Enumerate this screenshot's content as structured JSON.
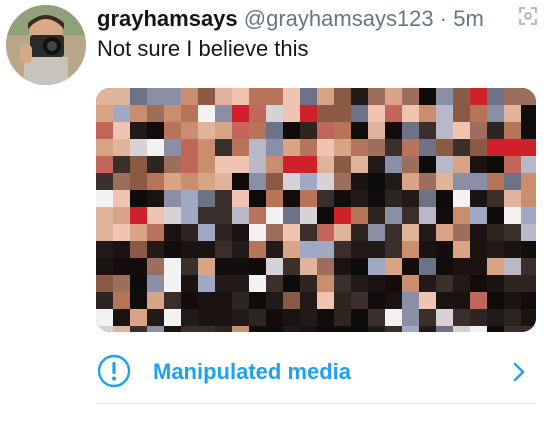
{
  "tweet": {
    "display_name": "grayhamsays",
    "handle": "@grayhamsays123",
    "separator": "·",
    "time": "5m",
    "text": "Not sure I believe this",
    "avatar_icon": "camera-photographer-avatar",
    "corner_icon": "expand-icon",
    "media_description_icon": "pixelated-image"
  },
  "label": {
    "text": "Manipulated media",
    "icon": "exclamation-circle-icon",
    "chevron": "chevron-right-icon",
    "color": "#1da1f2"
  },
  "colors": {
    "text": "#14171a",
    "secondary": "#657786",
    "divider": "#e1e8ed"
  }
}
